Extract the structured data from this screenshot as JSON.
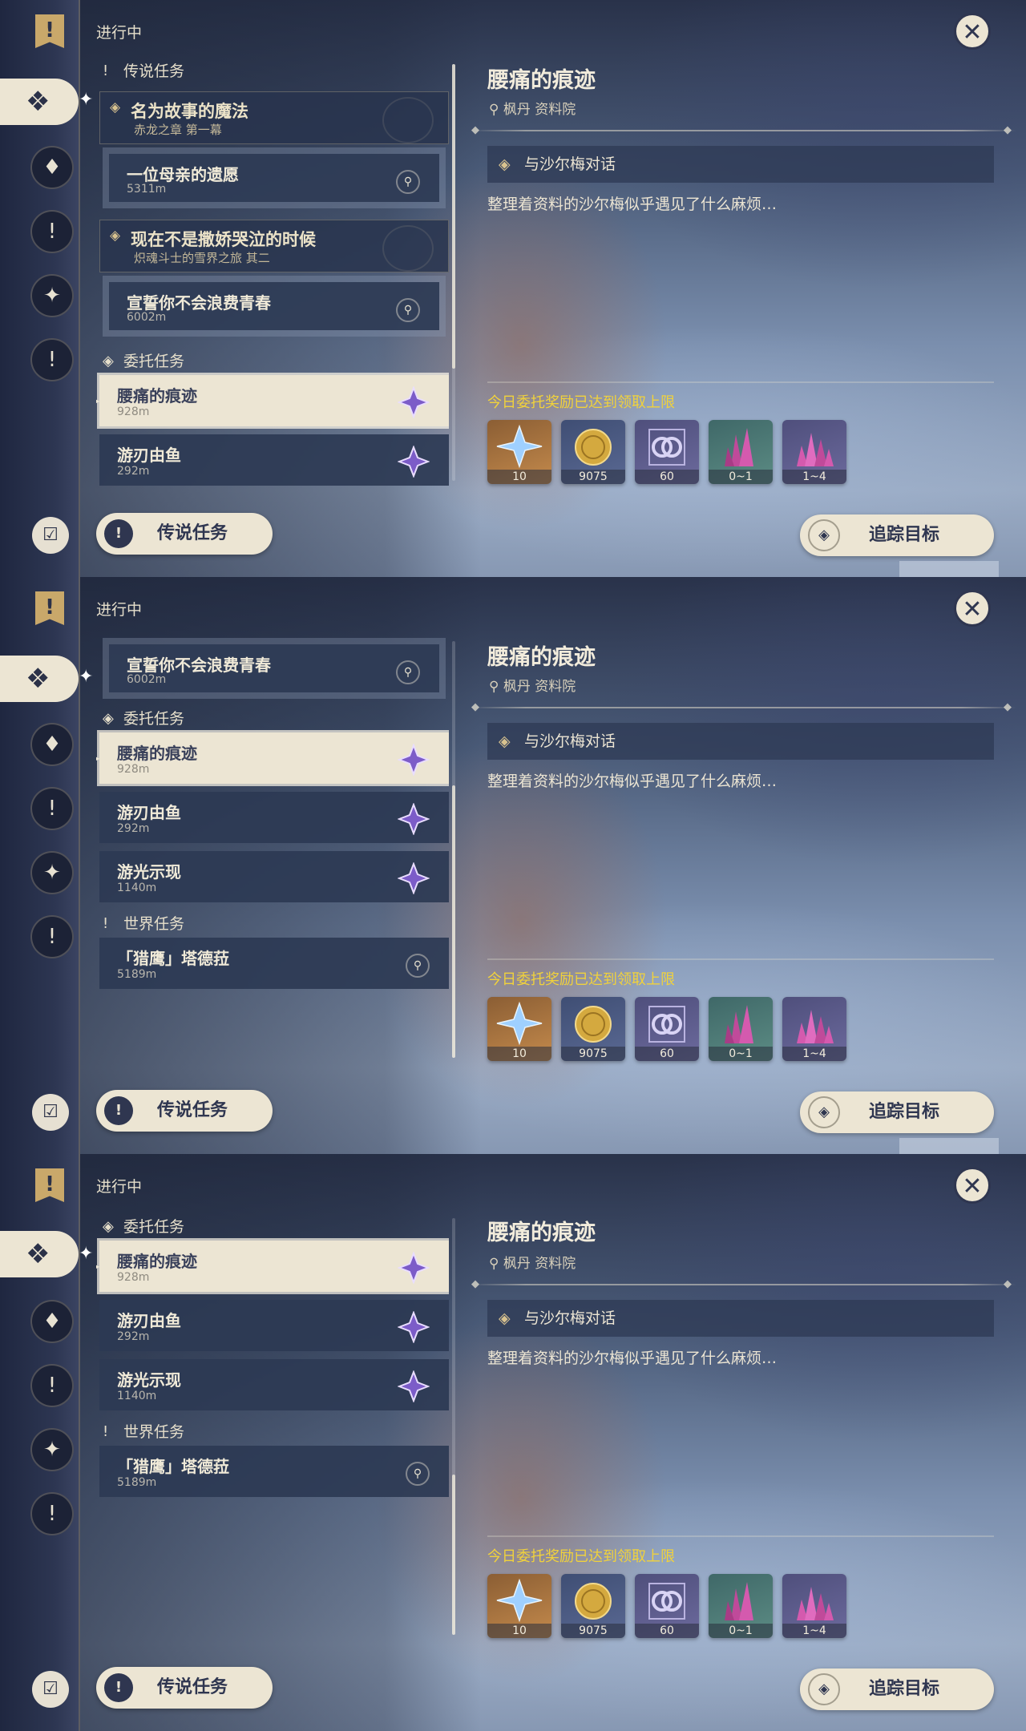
{
  "common": {
    "status_label": "进行中",
    "detail": {
      "title": "腰痛的痕迹",
      "location": "枫丹 资料院",
      "step": "与沙尔梅对话",
      "description": "整理着资料的沙尔梅似乎遇见了什么麻烦…",
      "reward_limit_note": "今日委托奖励已达到领取上限",
      "rewards": [
        {
          "name": "primogem",
          "qty": "10"
        },
        {
          "name": "mora",
          "qty": "9075"
        },
        {
          "name": "companionship-exp",
          "qty": "60"
        },
        {
          "name": "ore-crystal-small",
          "qty": "0~1"
        },
        {
          "name": "ore-crystal-large",
          "qty": "1~4"
        }
      ]
    },
    "buttons": {
      "legend_quests": "传说任务",
      "track_target": "追踪目标"
    },
    "icons": {
      "close": "close-icon",
      "map_pin": "map-pin-icon",
      "commission_star": "commission-star-icon"
    },
    "colors": {
      "accent_yellow": "#f1d23b",
      "cream": "#ece5d3",
      "navy": "#2f3650"
    }
  },
  "panels": [
    {
      "sections": [
        {
          "header": "传说任务",
          "chains": [
            {
              "title": "名为故事的魔法",
              "subtitle": "赤龙之章 第一幕",
              "quests": [
                {
                  "name": "一位母亲的遗愿",
                  "distance": "5311m"
                }
              ]
            },
            {
              "title": "现在不是撒娇哭泣的时候",
              "subtitle": "炽魂斗士的雪界之旅 其二",
              "quests": [
                {
                  "name": "宣誓你不会浪费青春",
                  "distance": "6002m"
                }
              ]
            }
          ]
        },
        {
          "header": "委托任务",
          "quests": [
            {
              "name": "腰痛的痕迹",
              "distance": "928m",
              "selected": true
            },
            {
              "name": "游刃由鱼",
              "distance": "292m"
            }
          ]
        }
      ]
    },
    {
      "sections": [
        {
          "header": "",
          "quests": [
            {
              "name": "宣誓你不会浪费青春",
              "distance": "6002m"
            }
          ]
        },
        {
          "header": "委托任务",
          "quests": [
            {
              "name": "腰痛的痕迹",
              "distance": "928m",
              "selected": true
            },
            {
              "name": "游刃由鱼",
              "distance": "292m"
            },
            {
              "name": "游光示现",
              "distance": "1140m"
            }
          ]
        },
        {
          "header": "世界任务",
          "quests": [
            {
              "name": "「猎鹰」塔德菈",
              "distance": "5189m"
            }
          ]
        }
      ]
    },
    {
      "sections": [
        {
          "header": "委托任务",
          "quests": [
            {
              "name": "腰痛的痕迹",
              "distance": "928m",
              "selected": true
            },
            {
              "name": "游刃由鱼",
              "distance": "292m"
            },
            {
              "name": "游光示现",
              "distance": "1140m"
            }
          ]
        },
        {
          "header": "世界任务",
          "quests": [
            {
              "name": "「猎鹰」塔德菈",
              "distance": "5189m"
            }
          ]
        }
      ]
    }
  ]
}
